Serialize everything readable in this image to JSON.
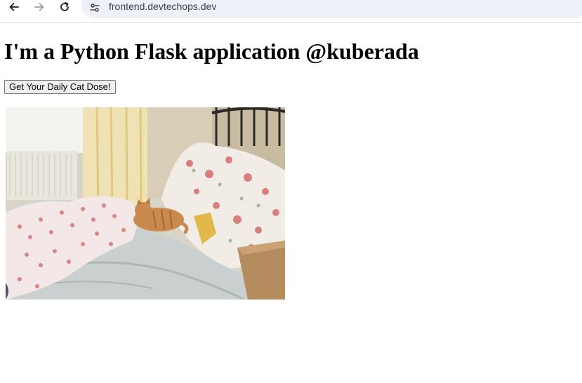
{
  "browser": {
    "url": "frontend.devtechops.dev",
    "icons": {
      "back": "back-arrow-icon",
      "forward": "forward-arrow-icon",
      "reload": "reload-icon",
      "site_info": "site-settings-icon"
    }
  },
  "page": {
    "title": "I'm a Python Flask application @kuberada",
    "button_label": "Get Your Daily Cat Dose!",
    "image_alt": "cat-photo-orange-tabby-on-floral-bed"
  },
  "colors": {
    "chrome_border": "#dadce0",
    "omnibox_bg": "#eef1f8",
    "button_bg": "#efefef"
  }
}
